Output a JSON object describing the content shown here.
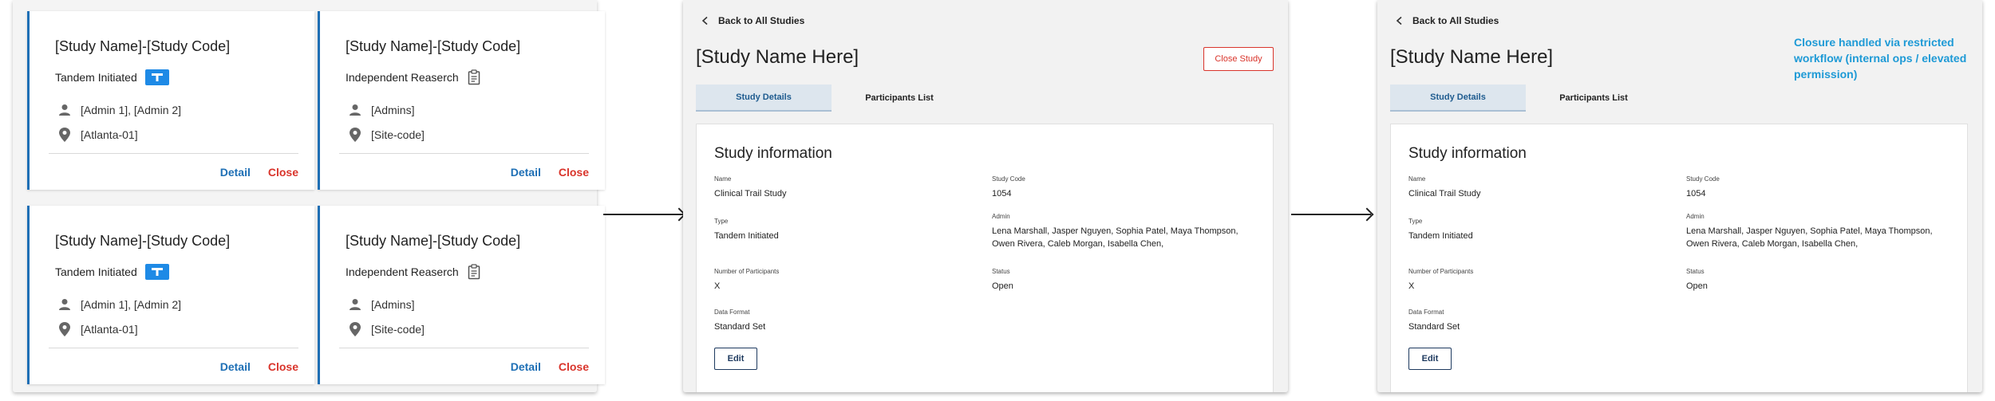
{
  "cards": [
    {
      "title": "[Study Name]-[Study Code]",
      "type": "Tandem Initiated",
      "type_icon": "tandem-badge-icon",
      "admins": "[Admin 1], [Admin 2]",
      "site": "[Atlanta-01]",
      "detail": "Detail",
      "close": "Close"
    },
    {
      "title": "[Study Name]-[Study Code]",
      "type": "Independent Reaserch",
      "type_icon": "clipboard-icon",
      "admins": "[Admins]",
      "site": "[Site-code]",
      "detail": "Detail",
      "close": "Close"
    },
    {
      "title": "[Study Name]-[Study Code]",
      "type": "Tandem Initiated",
      "type_icon": "tandem-badge-icon",
      "admins": "[Admin 1], [Admin 2]",
      "site": "[Atlanta-01]",
      "detail": "Detail",
      "close": "Close"
    },
    {
      "title": "[Study Name]-[Study Code]",
      "type": "Independent Reaserch",
      "type_icon": "clipboard-icon",
      "admins": "[Admins]",
      "site": "[Site-code]",
      "detail": "Detail",
      "close": "Close"
    }
  ],
  "detail_a": {
    "back": "Back to All Studies",
    "title": "[Study Name Here]",
    "close_button": "Close Study",
    "tabs": [
      "Study Details",
      "Participants List"
    ],
    "section_title": "Study information",
    "fields": {
      "name_label": "Name",
      "name": "Clinical Trail Study",
      "code_label": "Study Code",
      "code": "1054",
      "type_label": "Type",
      "type": "Tandem Initiated",
      "admin_label": "Admin",
      "admin": "Lena Marshall, Jasper Nguyen, Sophia Patel, Maya Thompson, Owen Rivera, Caleb Morgan, Isabella Chen,",
      "participants_label": "Number of Participants",
      "participants": "X",
      "status_label": "Status",
      "status": "Open",
      "format_label": "Data Format",
      "format": "Standard Set"
    },
    "edit": "Edit"
  },
  "detail_b": {
    "back": "Back to All Studies",
    "title": "[Study Name Here]",
    "note": "Closure handled via restricted workflow (internal ops / elevated permission)",
    "tabs": [
      "Study Details",
      "Participants List"
    ],
    "section_title": "Study information",
    "fields": {
      "name_label": "Name",
      "name": "Clinical Trail Study",
      "code_label": "Study Code",
      "code": "1054",
      "type_label": "Type",
      "type": "Tandem Initiated",
      "admin_label": "Admin",
      "admin": "Lena Marshall, Jasper Nguyen, Sophia Patel, Maya Thompson, Owen Rivera, Caleb Morgan, Isabella Chen,",
      "participants_label": "Number of Participants",
      "participants": "X",
      "status_label": "Status",
      "status": "Open",
      "format_label": "Data Format",
      "format": "Standard Set"
    },
    "edit": "Edit"
  },
  "colors": {
    "accent": "#1e6fb5",
    "danger": "#d9342b",
    "note": "#1e9ad6",
    "badge": "#1e8ae6"
  }
}
